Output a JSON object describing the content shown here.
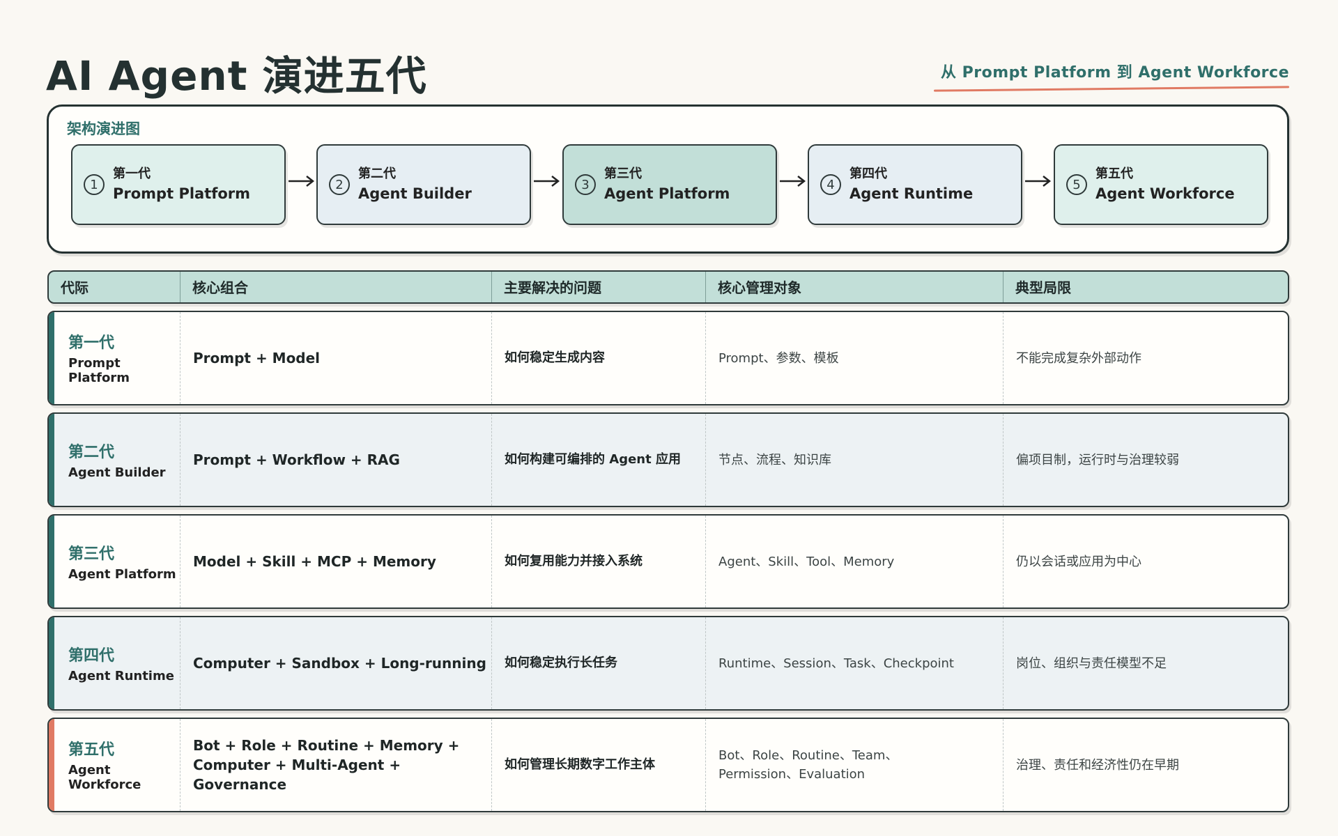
{
  "title": "AI Agent 演进五代",
  "subtitle": "从 Prompt Platform 到 Agent Workforce",
  "architecture": {
    "label": "架构演进图",
    "generations": [
      {
        "num": "1",
        "gen": "第一代",
        "name": "Prompt Platform"
      },
      {
        "num": "2",
        "gen": "第二代",
        "name": "Agent Builder"
      },
      {
        "num": "3",
        "gen": "第三代",
        "name": "Agent Platform"
      },
      {
        "num": "4",
        "gen": "第四代",
        "name": "Agent Runtime"
      },
      {
        "num": "5",
        "gen": "第五代",
        "name": "Agent Workforce"
      }
    ]
  },
  "table": {
    "headers": [
      "代际",
      "核心组合",
      "主要解决的问题",
      "核心管理对象",
      "典型局限"
    ],
    "rows": [
      {
        "gen": "第一代",
        "name": "Prompt Platform",
        "combo": "Prompt + Model",
        "problem": "如何稳定生成内容",
        "objects": "Prompt、参数、模板",
        "limits": "不能完成复杂外部动作"
      },
      {
        "gen": "第二代",
        "name": "Agent Builder",
        "combo": "Prompt + Workflow + RAG",
        "problem": "如何构建可编排的 Agent 应用",
        "objects": "节点、流程、知识库",
        "limits": "偏项目制，运行时与治理较弱"
      },
      {
        "gen": "第三代",
        "name": "Agent Platform",
        "combo": "Model + Skill + MCP + Memory",
        "problem": "如何复用能力并接入系统",
        "objects": "Agent、Skill、Tool、Memory",
        "limits": "仍以会话或应用为中心"
      },
      {
        "gen": "第四代",
        "name": "Agent Runtime",
        "combo": "Computer + Sandbox + Long-running",
        "problem": "如何稳定执行长任务",
        "objects": "Runtime、Session、Task、Checkpoint",
        "limits": "岗位、组织与责任模型不足"
      },
      {
        "gen": "第五代",
        "name": "Agent Workforce",
        "combo": "Bot + Role + Routine + Memory + Computer + Multi-Agent + Governance",
        "problem": "如何管理长期数字工作主体",
        "objects": "Bot、Role、Routine、Team、Permission、Evaluation",
        "limits": "治理、责任和经济性仍在早期"
      }
    ]
  },
  "colors": {
    "accent": "#2f6f6a",
    "coral": "#e07a63",
    "header_bg": "#c2dfd8",
    "box_mint": "#dff0ec",
    "box_blue": "#e6eef3",
    "row_tint": "#edf2f4"
  },
  "icons": [
    "circled-number-icon",
    "arrow-right-icon"
  ]
}
